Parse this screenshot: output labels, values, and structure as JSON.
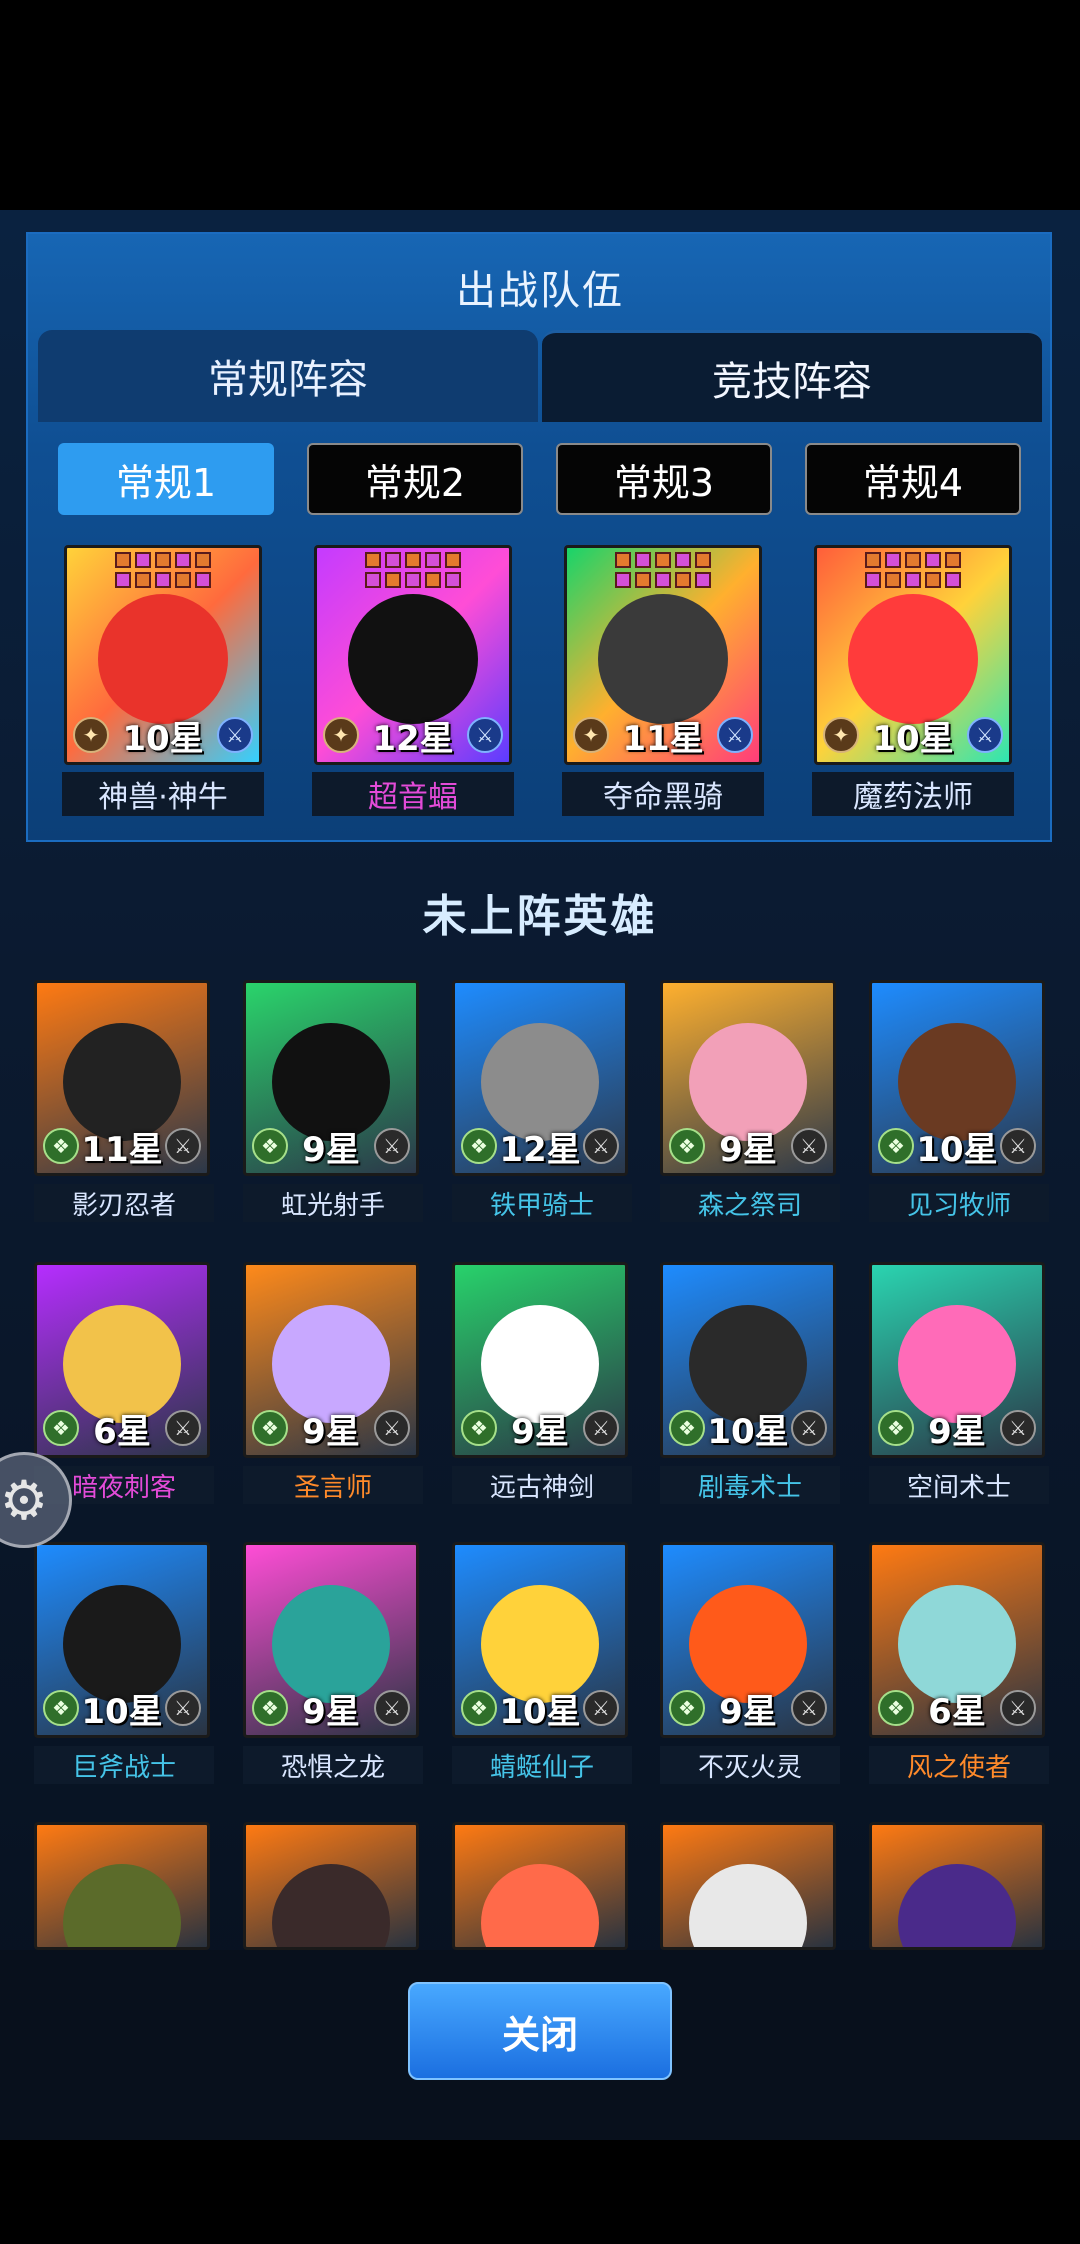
{
  "header": {
    "title": "出战队伍"
  },
  "main_tabs": [
    {
      "label": "常规阵容"
    },
    {
      "label": "竞技阵容"
    }
  ],
  "sub_tabs": [
    {
      "label": "常规1"
    },
    {
      "label": "常规2"
    },
    {
      "label": "常规3"
    },
    {
      "label": "常规4"
    }
  ],
  "team": [
    {
      "name": "神兽·神牛",
      "level": "10星",
      "name_color": "#d9e6ff",
      "bg": [
        "#ffd23a",
        "#ff6a3d",
        "#34d0ff"
      ],
      "face": "#e9332b"
    },
    {
      "name": "超音蝠",
      "level": "12星",
      "name_color": "#e34bd8",
      "bg": [
        "#c43bff",
        "#ff4dd6",
        "#5b3cff"
      ],
      "face": "#111111"
    },
    {
      "name": "夺命黑骑",
      "level": "11星",
      "name_color": "#d9e6ff",
      "bg": [
        "#18d46a",
        "#ffb02e",
        "#ff3d7a"
      ],
      "face": "#3a3a3a"
    },
    {
      "name": "魔药法师",
      "level": "10星",
      "name_color": "#d9e6ff",
      "bg": [
        "#ff5e3a",
        "#ffd23a",
        "#2ee6b2"
      ],
      "face": "#ff3b3b"
    }
  ],
  "roster_title": "未上阵英雄",
  "roster": [
    {
      "name": "影刃忍者",
      "level": "11星",
      "name_color": "#d9e6ff",
      "bg": "#ff7a12",
      "face": "#222222"
    },
    {
      "name": "虹光射手",
      "level": "9星",
      "name_color": "#d9e6ff",
      "bg": "#2ad46b",
      "face": "#111111"
    },
    {
      "name": "铁甲骑士",
      "level": "12星",
      "name_color": "#45c4e8",
      "bg": "#1e8cff",
      "face": "#8c8c8c"
    },
    {
      "name": "森之祭司",
      "level": "9星",
      "name_color": "#45c4e8",
      "bg": "#ffb02e",
      "face": "#f2a0b8"
    },
    {
      "name": "见习牧师",
      "level": "10星",
      "name_color": "#45c4e8",
      "bg": "#1e8cff",
      "face": "#6a3a22"
    },
    {
      "name": "暗夜刺客",
      "level": "6星",
      "name_color": "#e34bd8",
      "bg": "#b62dff",
      "face": "#f2c24a"
    },
    {
      "name": "圣言师",
      "level": "9星",
      "name_color": "#ff8a2a",
      "bg": "#ff8a1a",
      "face": "#c8a8ff"
    },
    {
      "name": "远古神剑",
      "level": "9星",
      "name_color": "#d9e6ff",
      "bg": "#28d26b",
      "face": "#ffffff"
    },
    {
      "name": "剧毒术士",
      "level": "10星",
      "name_color": "#45c4e8",
      "bg": "#1e8cff",
      "face": "#2a2a2a"
    },
    {
      "name": "空间术士",
      "level": "9星",
      "name_color": "#d9e6ff",
      "bg": "#2ad4b0",
      "face": "#ff6bb8"
    },
    {
      "name": "巨斧战士",
      "level": "10星",
      "name_color": "#45c4e8",
      "bg": "#1e8cff",
      "face": "#1a1a1a"
    },
    {
      "name": "恐惧之龙",
      "level": "9星",
      "name_color": "#d9e6ff",
      "bg": "#ff4dd6",
      "face": "#2aa39a"
    },
    {
      "name": "蜻蜓仙子",
      "level": "10星",
      "name_color": "#45c4e8",
      "bg": "#1e8cff",
      "face": "#ffd23a"
    },
    {
      "name": "不灭火灵",
      "level": "9星",
      "name_color": "#d9e6ff",
      "bg": "#1e8cff",
      "face": "#ff5a1a"
    },
    {
      "name": "风之使者",
      "level": "6星",
      "name_color": "#ff8a2a",
      "bg": "#ff7a12",
      "face": "#8fd8d8"
    },
    {
      "name": "",
      "level": "",
      "name_color": "#d9e6ff",
      "bg": "#ff7a12",
      "face": "#5b6b2a"
    },
    {
      "name": "",
      "level": "",
      "name_color": "#d9e6ff",
      "bg": "#ff7a12",
      "face": "#3a2a2a"
    },
    {
      "name": "",
      "level": "",
      "name_color": "#d9e6ff",
      "bg": "#ff7a12",
      "face": "#ff6a4a"
    },
    {
      "name": "",
      "level": "",
      "name_color": "#d9e6ff",
      "bg": "#ff7a12",
      "face": "#e8e8e8"
    },
    {
      "name": "",
      "level": "",
      "name_color": "#d9e6ff",
      "bg": "#ff7a12",
      "face": "#4a2a8a"
    }
  ],
  "close_button": {
    "label": "关闭"
  },
  "icons": {
    "settings": "gear-icon"
  }
}
